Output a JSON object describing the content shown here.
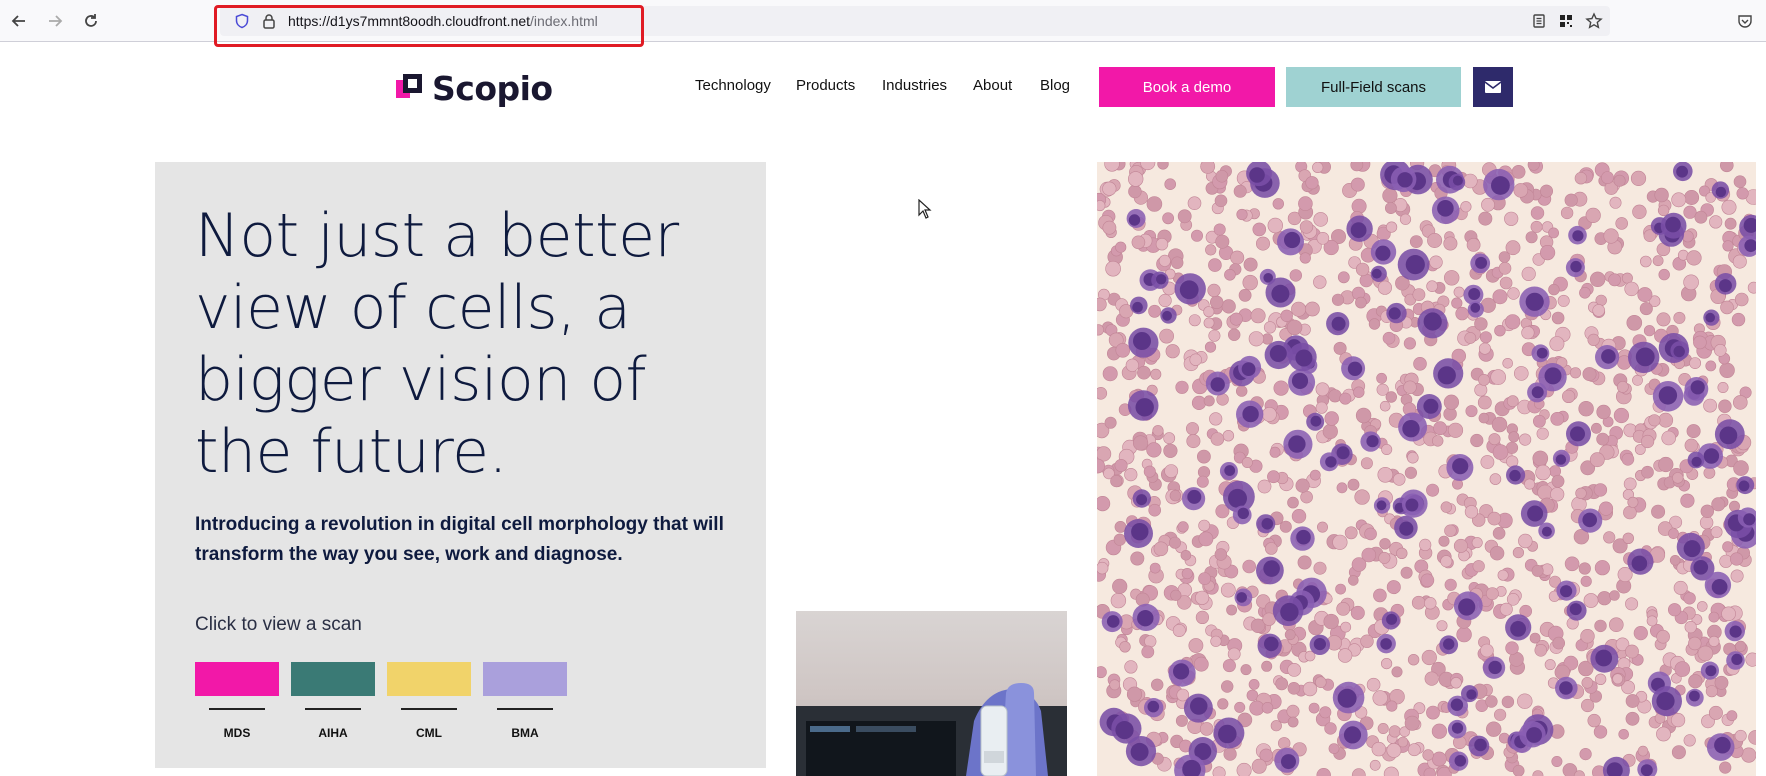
{
  "browser": {
    "url_host": "https://d1ys7mmnt8oodh.cloudfront.net",
    "url_path": "/index.html",
    "icons": [
      "back-icon",
      "forward-icon",
      "reload-icon",
      "shield-icon",
      "lock-icon",
      "reader-view-icon",
      "qr-code-icon",
      "bookmark-star-icon",
      "pocket-icon"
    ]
  },
  "site": {
    "brand": "Scopio",
    "nav": [
      "Technology",
      "Products",
      "Industries",
      "About",
      "Blog"
    ],
    "cta_demo": "Book a demo",
    "cta_scans": "Full-Field scans",
    "mail_icon": "mail-icon"
  },
  "hero": {
    "title": "Not just a better view of cells, a bigger vision of the future.",
    "subtitle": "Introducing a revolution in digital cell morphology that will transform the way you see, work and diagnose.",
    "scan_prompt": "Click to view a scan",
    "scans": [
      {
        "label": "MDS",
        "color": "#f218a8"
      },
      {
        "label": "AIHA",
        "color": "#3a7a75"
      },
      {
        "label": "CML",
        "color": "#f1d36a"
      },
      {
        "label": "BMA",
        "color": "#aaa0dc"
      }
    ]
  },
  "colors": {
    "accent_pink": "#f218a8",
    "accent_teal": "#9fd2d2",
    "navy": "#2e2a6b",
    "hero_bg": "#e5e5e5",
    "url_highlight": "#e01b24"
  }
}
